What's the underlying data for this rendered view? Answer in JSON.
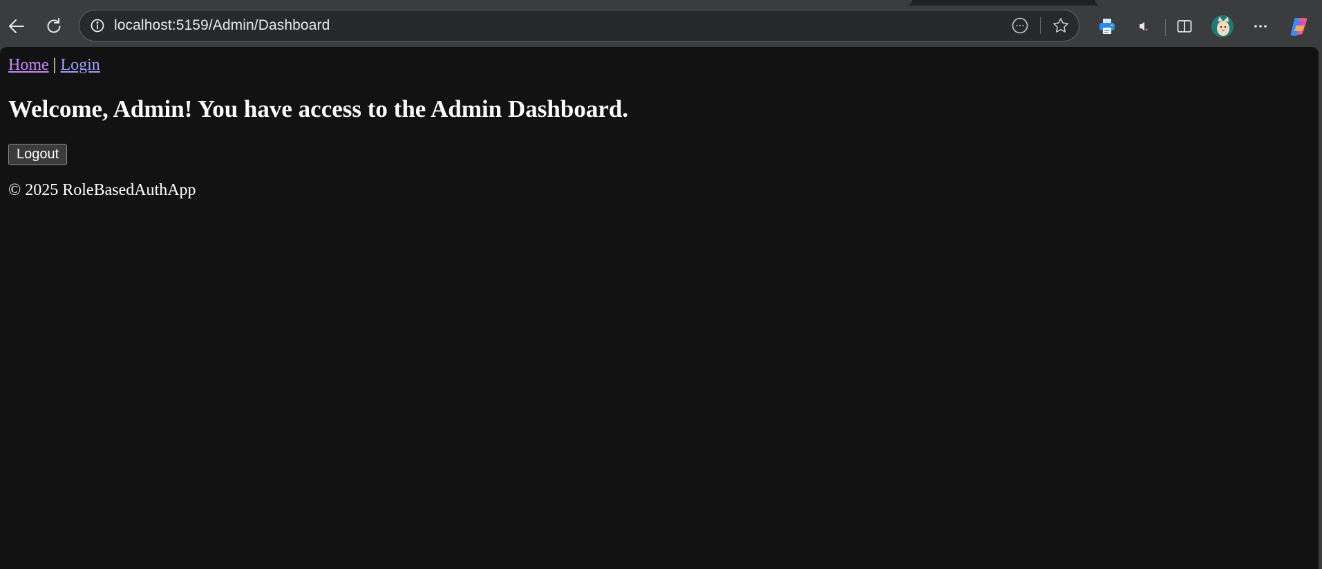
{
  "browser": {
    "url": "localhost:5159/Admin/Dashboard",
    "icons": {
      "back": "arrow-left-icon",
      "reload": "reload-icon",
      "site_info": "info-icon",
      "reader": "more-circle-icon",
      "favorite": "star-icon",
      "extension": "printer-extension-icon",
      "media": "speaker-icon",
      "split_screen": "split-screen-icon",
      "profile": "avatar",
      "menu": "ellipsis-icon",
      "copilot": "copilot-icon"
    }
  },
  "page": {
    "nav": {
      "home_label": "Home",
      "separator": "|",
      "login_label": "Login"
    },
    "heading": "Welcome, Admin! You have access to the Admin Dashboard.",
    "logout_label": "Logout",
    "footer": "© 2025 RoleBasedAuthApp"
  },
  "colors": {
    "page_background": "#121212",
    "chrome_background": "#3b3c3e",
    "visited_link": "#c58af9",
    "link": "#9e9eff",
    "text": "#ffffff"
  }
}
